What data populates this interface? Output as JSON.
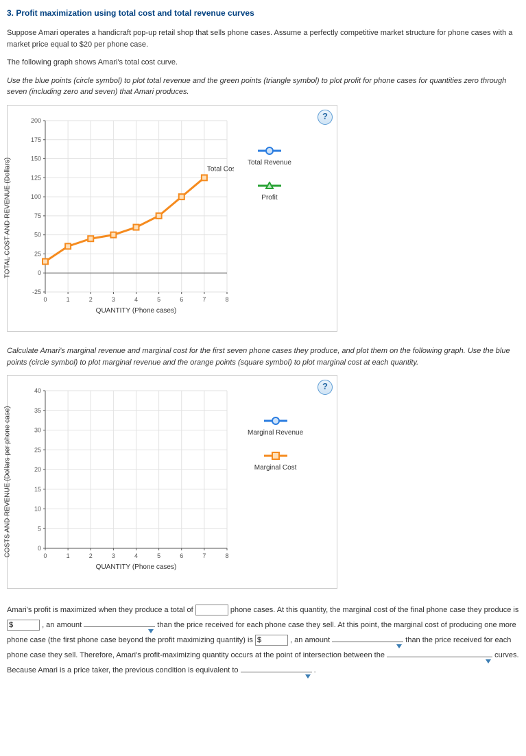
{
  "heading": "3. Profit maximization using total cost and total revenue curves",
  "p1": "Suppose Amari operates a handicraft pop-up retail shop that sells phone cases. Assume a perfectly competitive market structure for phone cases with a market price equal to $20 per phone case.",
  "p2": "The following graph shows Amari's total cost curve.",
  "p3": "Use the blue points (circle symbol) to plot total revenue and the green points (triangle symbol) to plot profit for phone cases for quantities zero through seven (including zero and seven) that Amari produces.",
  "p4": "Calculate Amari's marginal revenue and marginal cost for the first seven phone cases they produce, and plot them on the following graph. Use the blue points (circle symbol) to plot marginal revenue and the orange points (square symbol) to plot marginal cost at each quantity.",
  "help": "?",
  "chart1": {
    "ylabel": "TOTAL COST AND REVENUE (Dollars)",
    "xlabel": "QUANTITY (Phone cases)",
    "series_label": "Total Cost",
    "legend": {
      "tr": "Total Revenue",
      "pr": "Profit"
    }
  },
  "chart2": {
    "ylabel": "COSTS AND REVENUE (Dollars per phone case)",
    "xlabel": "QUANTITY (Phone cases)",
    "legend": {
      "mr": "Marginal Revenue",
      "mc": "Marginal Cost"
    }
  },
  "fill": {
    "t1": "Amari's profit is maximized when they produce a total of ",
    "t2": " phone cases. At this quantity, the marginal cost of the final phone case they produce is ",
    "t3": " , an amount ",
    "t4": " than the price received for each phone case they sell. At this point, the marginal cost of producing one more phone case (the first phone case beyond the profit maximizing quantity) is ",
    "t5": " , an amount ",
    "t6": " than the price received for each phone case they sell. Therefore, Amari's profit-maximizing quantity occurs at the point of intersection between the ",
    "t7": " curves. Because Amari is a price taker, the previous condition is equivalent to ",
    "t8": " .",
    "dollar": "$"
  },
  "chart_data": [
    {
      "type": "line",
      "title": "",
      "xlabel": "QUANTITY (Phone cases)",
      "ylabel": "TOTAL COST AND REVENUE (Dollars)",
      "xlim": [
        0,
        8
      ],
      "ylim": [
        -25,
        200
      ],
      "xticks": [
        0,
        1,
        2,
        3,
        4,
        5,
        6,
        7,
        8
      ],
      "yticks": [
        -25,
        0,
        25,
        50,
        75,
        100,
        125,
        150,
        175,
        200
      ],
      "series": [
        {
          "name": "Total Cost",
          "symbol": "square",
          "color": "#f58b1f",
          "x": [
            0,
            1,
            2,
            3,
            4,
            5,
            6,
            7
          ],
          "values": [
            15,
            35,
            45,
            50,
            60,
            75,
            100,
            125
          ]
        }
      ],
      "palette_tools": [
        {
          "name": "Total Revenue",
          "symbol": "circle",
          "color": "#2b7de0"
        },
        {
          "name": "Profit",
          "symbol": "triangle",
          "color": "#2aa336"
        }
      ]
    },
    {
      "type": "line",
      "title": "",
      "xlabel": "QUANTITY (Phone cases)",
      "ylabel": "COSTS AND REVENUE (Dollars per phone case)",
      "xlim": [
        0,
        8
      ],
      "ylim": [
        0,
        40
      ],
      "xticks": [
        0,
        1,
        2,
        3,
        4,
        5,
        6,
        7,
        8
      ],
      "yticks": [
        0,
        5,
        10,
        15,
        20,
        25,
        30,
        35,
        40
      ],
      "series": [],
      "palette_tools": [
        {
          "name": "Marginal Revenue",
          "symbol": "circle",
          "color": "#2b7de0"
        },
        {
          "name": "Marginal Cost",
          "symbol": "square",
          "color": "#f58b1f"
        }
      ]
    }
  ]
}
